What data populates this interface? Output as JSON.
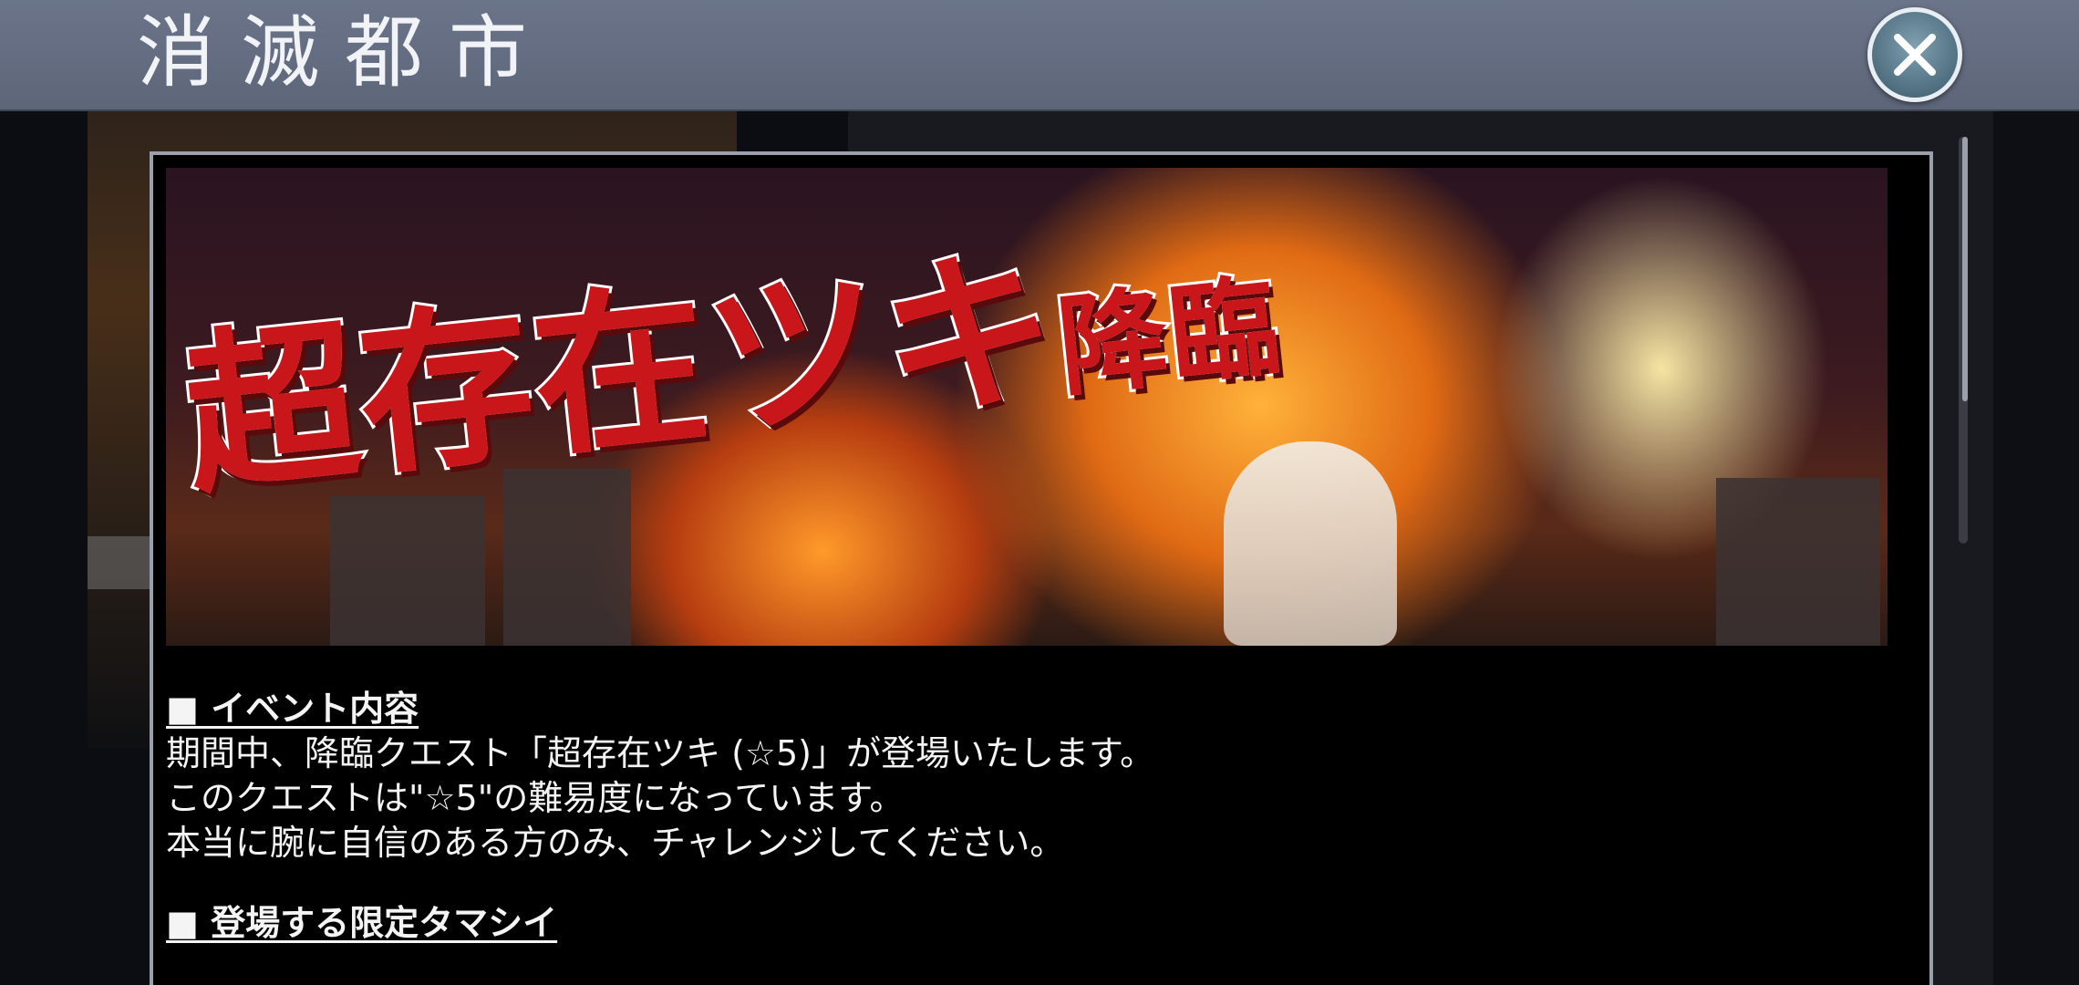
{
  "header": {
    "title": "消滅都市",
    "close_icon": "close-icon"
  },
  "banner": {
    "title_part1": "超存在",
    "title_part2": "ツキ",
    "title_part3": "降臨"
  },
  "event": {
    "section1_heading": "■ イベント内容",
    "lines": [
      "期間中、降臨クエスト「超存在ツキ (☆5)」が登場いたします。",
      "このクエストは\"☆5\"の難易度になっています。",
      "本当に腕に自信のある方のみ、チャレンジしてください。"
    ],
    "section2_heading": "■ 登場する限定タマシイ"
  },
  "colors": {
    "header_bg": "#636c80",
    "banner_title_red": "#c8161a",
    "modal_bg": "#000000"
  }
}
